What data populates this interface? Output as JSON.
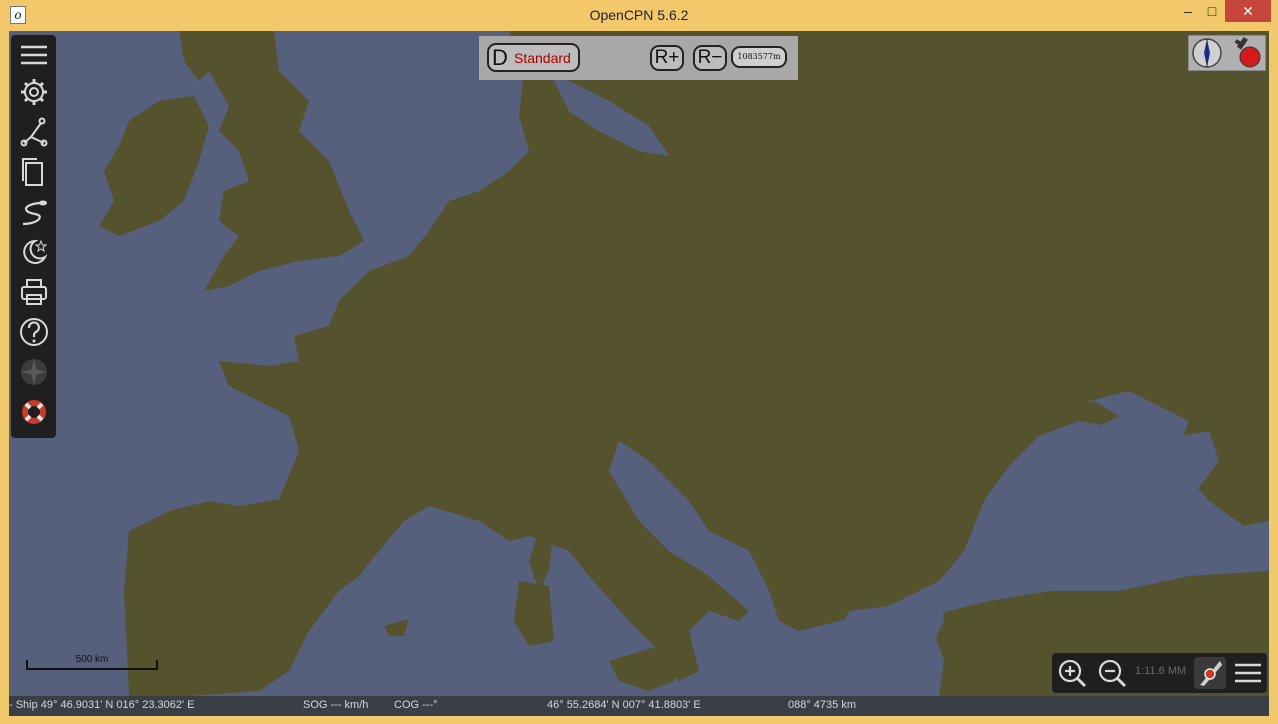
{
  "window": {
    "title": "OpenCPN 5.6.2",
    "app_icon_glyph": "o",
    "minimize_glyph": "–",
    "maximize_glyph": "□",
    "close_glyph": "✕"
  },
  "colors": {
    "water": "#565f7b",
    "land": "#55532e",
    "title_bar": "#f2c86b",
    "toolbar": "#1f1f1f",
    "chart_text_accent": "#a00000"
  },
  "toolbar": {
    "items": [
      {
        "name": "menu",
        "icon": "hamburger-icon"
      },
      {
        "name": "settings",
        "icon": "gear-icon"
      },
      {
        "name": "route",
        "icon": "route-icon"
      },
      {
        "name": "route-manager",
        "icon": "pages-icon"
      },
      {
        "name": "track",
        "icon": "track-icon"
      },
      {
        "name": "color-scheme",
        "icon": "moon-star-icon"
      },
      {
        "name": "print",
        "icon": "printer-icon"
      },
      {
        "name": "help",
        "icon": "help-icon"
      },
      {
        "name": "autofollow",
        "icon": "compass-rose-icon"
      },
      {
        "name": "mob",
        "icon": "lifebuoy-icon"
      }
    ]
  },
  "chart_bar": {
    "mode_letter": "D",
    "display_category": "Standard",
    "range_plus": "R+",
    "range_minus": "R−",
    "range_value": "1083577m"
  },
  "scale_bar": {
    "label": "500 km"
  },
  "zoom_bar": {
    "scale": "1:11.6 MM"
  },
  "status_bar": {
    "ship": "- Ship 49° 46.9031' N   016° 23.3062' E",
    "sog": "SOG --- km/h",
    "cog": "COG ---°",
    "cursor": "46° 55.2684' N   007° 41.8803' E",
    "bearing_distance": "088°  4735 km"
  }
}
